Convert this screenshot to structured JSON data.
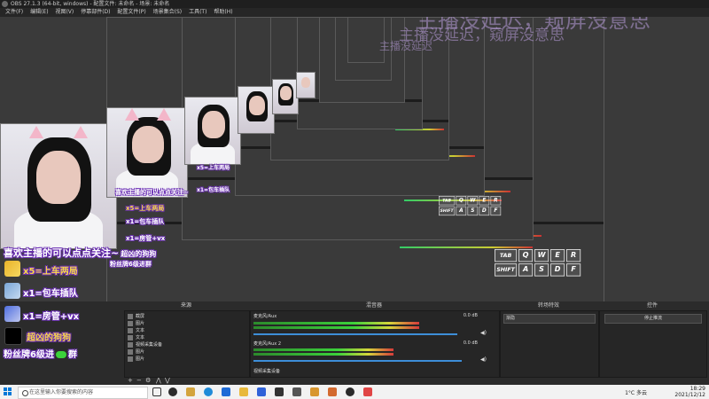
{
  "window": {
    "title": "OBS 27.1.3 (64-bit, windows) - 配置文件: 未命名 - 场景: 未命名"
  },
  "menu": [
    "文件(F)",
    "编辑(E)",
    "视图(V)",
    "停靠部件(D)",
    "配置文件(P)",
    "场景集合(S)",
    "工具(T)",
    "帮助(H)"
  ],
  "watermark": {
    "line1": "主播没延迟，窥屏没意思",
    "line2": "主播没延迟，窥屏没意思",
    "line3": "主播没延迟"
  },
  "overlay": {
    "follow_text": "喜欢主播的可以点点关注~",
    "follow_sub": "超凶的狗狗",
    "reward_1": "x5=上车两局",
    "reward_2": "x1=包车插队",
    "reward_3": "x1=房管+vx",
    "tiktok_label": "超凶的狗狗",
    "fans_label": "粉丝牌6级进",
    "group_label": "群"
  },
  "keyboard": {
    "row1_prefix": "TAB",
    "row1": [
      "Q",
      "W",
      "E",
      "R"
    ],
    "row2_prefix": "SHIFT",
    "row2": [
      "A",
      "S",
      "D",
      "F"
    ]
  },
  "docks": {
    "sources_title": "来源",
    "mixer_title": "混音器",
    "transitions_title": "转场特效",
    "controls_title": "控件"
  },
  "sources": [
    {
      "label": "截屏"
    },
    {
      "label": "图片"
    },
    {
      "label": "文本"
    },
    {
      "label": "文本"
    },
    {
      "label": "视频采集设备"
    },
    {
      "label": "图片"
    },
    {
      "label": "图片"
    }
  ],
  "mixer": [
    {
      "name": "麦克风/Aux",
      "value": "0.0 dB",
      "level": 0.78,
      "volume": 0.96
    },
    {
      "name": "麦克风/Aux 2",
      "value": "0.0 dB",
      "level": 0.66,
      "volume": 0.98
    }
  ],
  "mixer_footer": "视频采集设备",
  "transitions": {
    "selected": "渐隐"
  },
  "controls": {
    "stop_stream": "停止推流"
  },
  "taskbar": {
    "search_placeholder": "在这里输入你要搜索的内容",
    "temperature": "1°C 多云",
    "time": "18:29",
    "date": "2021/12/12"
  },
  "colors": {
    "accent_purple": "#6b2fb5",
    "meter_green": "#3bd13b",
    "meter_yellow": "#d6d63b",
    "meter_red": "#d63b3b",
    "slider_blue": "#3d8ed8"
  }
}
